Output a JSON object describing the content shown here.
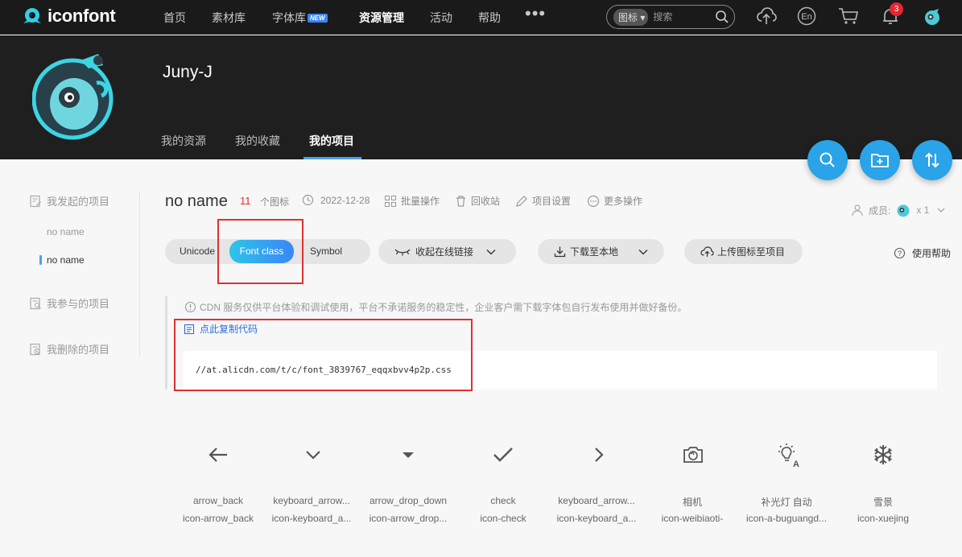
{
  "nav": {
    "logo": "iconfont",
    "items": [
      "首页",
      "素材库",
      "字体库",
      "资源管理",
      "活动",
      "帮助"
    ],
    "new_badge": "NEW",
    "search_type": "图标",
    "search_placeholder": "搜索",
    "notification_count": "3"
  },
  "profile": {
    "username": "Juny-J",
    "tabs": [
      "我的资源",
      "我的收藏",
      "我的项目"
    ]
  },
  "sidebar": {
    "initiated": "我发起的项目",
    "projects": [
      "no name",
      "no name"
    ],
    "participated": "我参与的项目",
    "deleted": "我删除的项目"
  },
  "project": {
    "name": "no name",
    "icon_count": "11",
    "icon_count_label": "个图标",
    "date": "2022-12-28",
    "batch_ops": "批量操作",
    "recycle": "回收站",
    "settings": "项目设置",
    "more_ops": "更多操作",
    "members_label": "成员:",
    "members_count": "x 1"
  },
  "toolbar": {
    "formats": [
      "Unicode",
      "Font class",
      "Symbol"
    ],
    "collapse_link": "收起在线链接",
    "download": "下载至本地",
    "upload": "上传图标至项目",
    "help": "使用帮助"
  },
  "cdn": {
    "notice": "CDN 服务仅供平台体验和调试使用，平台不承诺服务的稳定性，企业客户需下载字体包自行发布使用并做好备份。",
    "copy_label": "点此复制代码",
    "url": "//at.alicdn.com/t/c/font_3839767_eqqxbvv4p2p.css"
  },
  "icons": [
    {
      "name": "arrow_back",
      "class": "icon-arrow_back",
      "glyph": "arrow-back"
    },
    {
      "name": "keyboard_arrow...",
      "class": "icon-keyboard_a...",
      "glyph": "chevron-down"
    },
    {
      "name": "arrow_drop_down",
      "class": "icon-arrow_drop...",
      "glyph": "caret-down"
    },
    {
      "name": "check",
      "class": "icon-check",
      "glyph": "check"
    },
    {
      "name": "keyboard_arrow...",
      "class": "icon-keyboard_a...",
      "glyph": "chevron-right"
    },
    {
      "name": "相机",
      "class": "icon-weibiaoti-",
      "glyph": "camera"
    },
    {
      "name": "补光灯 自动",
      "class": "icon-a-buguangd...",
      "glyph": "fill-light-auto"
    },
    {
      "name": "雪景",
      "class": "icon-xuejing",
      "glyph": "snowflake"
    }
  ],
  "colors": {
    "accent": "#2aa3e8",
    "count_red": "#e8262f",
    "link_blue": "#2b6ee0",
    "nav_bg": "#1a1a1a"
  }
}
